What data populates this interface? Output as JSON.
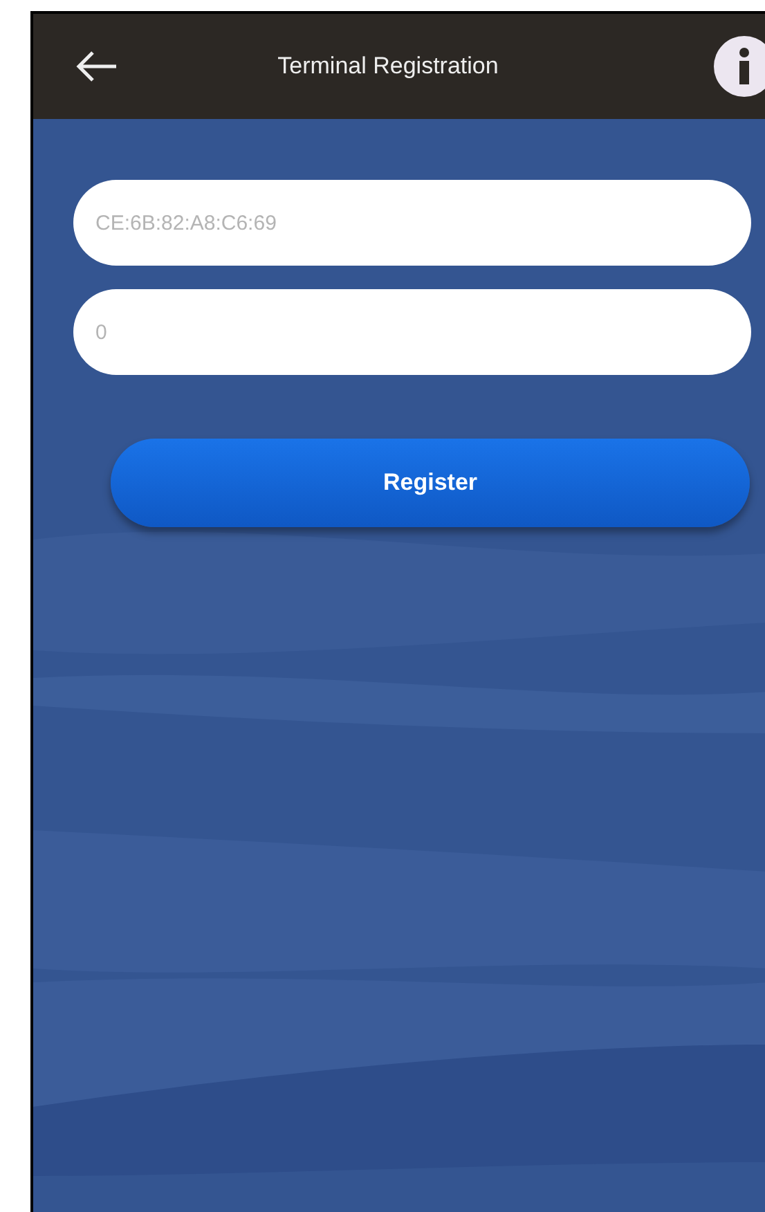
{
  "header": {
    "title": "Terminal Registration"
  },
  "fields": [
    {
      "placeholder": "CE:6B:82:A8:C6:69"
    },
    {
      "placeholder": "0"
    }
  ],
  "buttons": [
    {
      "label": "Register"
    }
  ]
}
